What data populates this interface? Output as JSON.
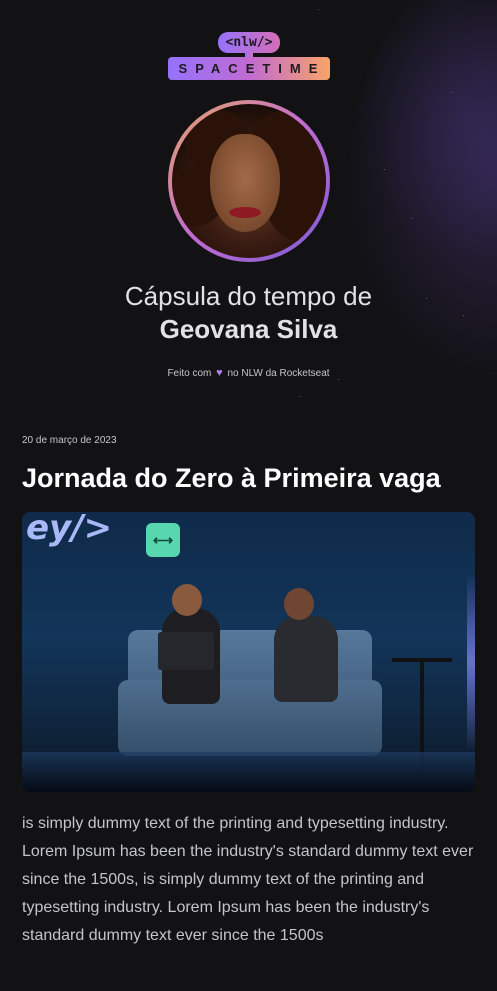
{
  "logo": {
    "tag": "<nlw/>",
    "word": "SPACETIME"
  },
  "header": {
    "title_prefix": "Cápsula do tempo de",
    "title_name": "Geovana Silva",
    "made_with_prefix": "Feito com",
    "made_with_icon": "purple-heart-icon",
    "made_with_suffix": "no NLW da Rocketseat"
  },
  "memory": {
    "date": "20 de março de 2023",
    "title": "Jornada do Zero à Primeira vaga",
    "cover_overlay_text": "ey/>",
    "cover_badge_icon": "expand-arrows-icon",
    "content": "is simply dummy text of the printing and typesetting industry. Lorem Ipsum has been the industry's standard dummy text ever since the 1500s, is simply dummy text of the printing and typesetting industry. Lorem Ipsum has been the industry's standard dummy text ever since the 1500s"
  },
  "colors": {
    "background": "#121215",
    "accent_purple": "#9572fc",
    "accent_pink": "#d66eb8",
    "accent_orange": "#f9a36a",
    "text_primary": "#e1e1e6",
    "text_secondary": "#c4c4cc"
  }
}
